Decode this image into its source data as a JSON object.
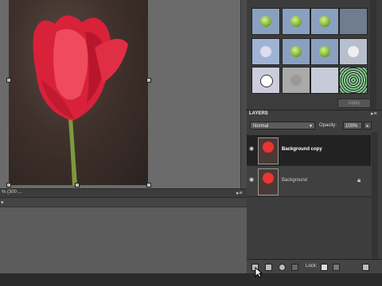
{
  "canvas": {
    "status_text": "% (300 ..."
  },
  "effects": {
    "thumbnails": [
      "effect-1",
      "effect-2",
      "effect-3",
      "effect-4",
      "effect-5",
      "effect-6",
      "effect-7",
      "effect-8",
      "effect-9",
      "effect-10",
      "effect-11",
      "effect-12"
    ],
    "apply_label": "Apply"
  },
  "layers": {
    "tab_label": "LAYERS",
    "blend_mode": "Normal",
    "opacity_label": "Opacity:",
    "opacity_value": "100%",
    "rows": [
      {
        "name": "Background copy",
        "selected": true,
        "visible": true,
        "locked": false
      },
      {
        "name": "Background",
        "selected": false,
        "visible": true,
        "locked": true
      }
    ],
    "lock_label": "Lock:"
  },
  "icons": {
    "eye": "eye-icon",
    "lock": "lock-icon",
    "panel_menu": "panel-menu-icon",
    "new_layer": "new-layer-icon",
    "trash": "trash-icon",
    "cursor": "mouse-cursor"
  }
}
